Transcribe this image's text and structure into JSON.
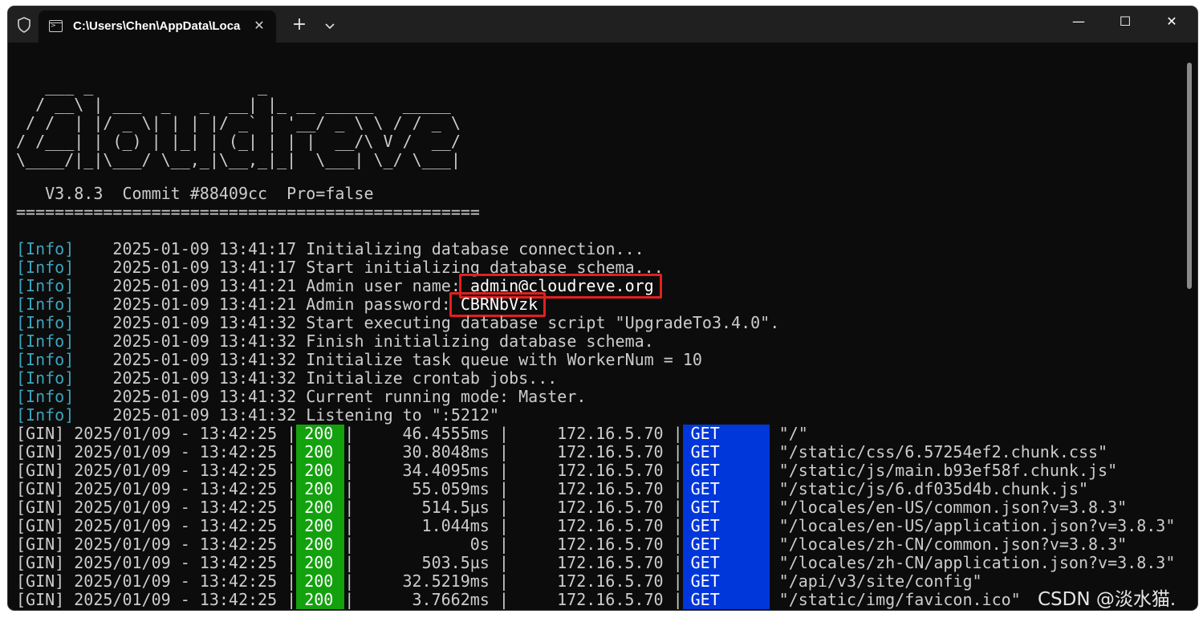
{
  "window": {
    "tab_title": "C:\\Users\\Chen\\AppData\\Loca",
    "controls": {
      "minimize": "—",
      "maximize": "☐",
      "close": "✕"
    },
    "new_tab": "+",
    "tab_close": "✕"
  },
  "banner": {
    "ascii": "   ___ _                 _\n  / __\\ | ___  _   _  __| |_ __ _____   _____\n / /  | |/ _ \\| | | |/ _` | '__/ _ \\ \\ / / _ \\\n/ /___| | (_) | |_| | (_| | | |  __/\\ V /  __/\n\\____/|_|\\___/ \\__,_|\\__,_|_|  \\___| \\_/ \\___|",
    "version": "   V3.8.3  Commit #88409cc  Pro=false",
    "separator": "================================================"
  },
  "info_lines": [
    {
      "tag": "[Info]",
      "time": "2025-01-09 13:41:17",
      "msg": "Initializing database connection...",
      "hl": ""
    },
    {
      "tag": "[Info]",
      "time": "2025-01-09 13:41:17",
      "msg": "Start initializing database schema...",
      "hl": ""
    },
    {
      "tag": "[Info]",
      "time": "2025-01-09 13:41:21",
      "msg": "Admin user name: ",
      "hl": "admin@cloudreve.org"
    },
    {
      "tag": "[Info]",
      "time": "2025-01-09 13:41:21",
      "msg": "Admin password: ",
      "hl": "CBRNbVzk"
    },
    {
      "tag": "[Info]",
      "time": "2025-01-09 13:41:32",
      "msg": "Start executing database script \"UpgradeTo3.4.0\".",
      "hl": ""
    },
    {
      "tag": "[Info]",
      "time": "2025-01-09 13:41:32",
      "msg": "Finish initializing database schema.",
      "hl": ""
    },
    {
      "tag": "[Info]",
      "time": "2025-01-09 13:41:32",
      "msg": "Initialize task queue with WorkerNum = 10",
      "hl": ""
    },
    {
      "tag": "[Info]",
      "time": "2025-01-09 13:41:32",
      "msg": "Initialize crontab jobs...",
      "hl": ""
    },
    {
      "tag": "[Info]",
      "time": "2025-01-09 13:41:32",
      "msg": "Current running mode: Master.",
      "hl": ""
    },
    {
      "tag": "[Info]",
      "time": "2025-01-09 13:41:32",
      "msg": "Listening to \":5212\"",
      "hl": ""
    }
  ],
  "gin_lines": [
    {
      "prefix": "[GIN] 2025/01/09 - 13:42:25 |",
      "status": "200",
      "latency": "     46.4555ms |",
      "ip": "     172.16.5.70 |",
      "method": "GET",
      "path": "\"/\""
    },
    {
      "prefix": "[GIN] 2025/01/09 - 13:42:25 |",
      "status": "200",
      "latency": "     30.8048ms |",
      "ip": "     172.16.5.70 |",
      "method": "GET",
      "path": "\"/static/css/6.57254ef2.chunk.css\""
    },
    {
      "prefix": "[GIN] 2025/01/09 - 13:42:25 |",
      "status": "200",
      "latency": "     34.4095ms |",
      "ip": "     172.16.5.70 |",
      "method": "GET",
      "path": "\"/static/js/main.b93ef58f.chunk.js\""
    },
    {
      "prefix": "[GIN] 2025/01/09 - 13:42:25 |",
      "status": "200",
      "latency": "      55.059ms |",
      "ip": "     172.16.5.70 |",
      "method": "GET",
      "path": "\"/static/js/6.df035d4b.chunk.js\""
    },
    {
      "prefix": "[GIN] 2025/01/09 - 13:42:25 |",
      "status": "200",
      "latency": "       514.5µs |",
      "ip": "     172.16.5.70 |",
      "method": "GET",
      "path": "\"/locales/en-US/common.json?v=3.8.3\""
    },
    {
      "prefix": "[GIN] 2025/01/09 - 13:42:25 |",
      "status": "200",
      "latency": "       1.044ms |",
      "ip": "     172.16.5.70 |",
      "method": "GET",
      "path": "\"/locales/en-US/application.json?v=3.8.3\""
    },
    {
      "prefix": "[GIN] 2025/01/09 - 13:42:25 |",
      "status": "200",
      "latency": "            0s |",
      "ip": "     172.16.5.70 |",
      "method": "GET",
      "path": "\"/locales/zh-CN/common.json?v=3.8.3\""
    },
    {
      "prefix": "[GIN] 2025/01/09 - 13:42:25 |",
      "status": "200",
      "latency": "       503.5µs |",
      "ip": "     172.16.5.70 |",
      "method": "GET",
      "path": "\"/locales/zh-CN/application.json?v=3.8.3\""
    },
    {
      "prefix": "[GIN] 2025/01/09 - 13:42:25 |",
      "status": "200",
      "latency": "     32.5219ms |",
      "ip": "     172.16.5.70 |",
      "method": "GET",
      "path": "\"/api/v3/site/config\""
    },
    {
      "prefix": "[GIN] 2025/01/09 - 13:42:25 |",
      "status": "200",
      "latency": "      3.7662ms |",
      "ip": "     172.16.5.70 |",
      "method": "GET",
      "path": "\"/static/img/favicon.ico\""
    }
  ],
  "watermark": "CSDN @淡水猫.",
  "colors": {
    "info_tag": "#3aa5bd",
    "status_bg": "#13a10e",
    "method_bg": "#0037da",
    "highlight_border": "#e0201d"
  }
}
